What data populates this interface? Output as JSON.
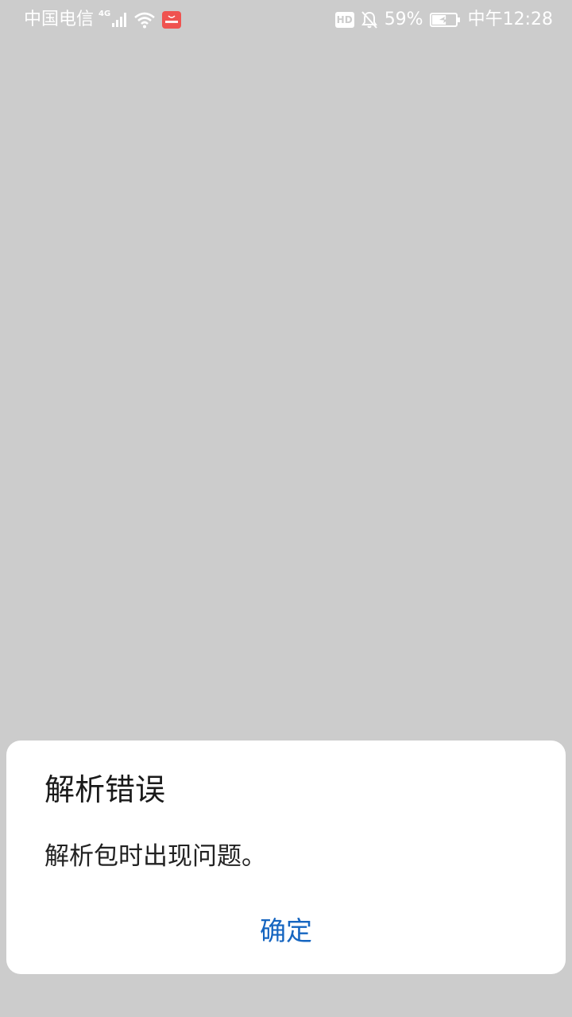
{
  "status_bar": {
    "carrier": "中国电信",
    "network_type": "4G",
    "battery_percent": "59%",
    "time": "中午12:28",
    "hd_label": "HD",
    "app_badge_label": "HUAWEI",
    "icons": [
      "signal-icon",
      "wifi-icon",
      "huawei-appgallery-icon",
      "hd-icon",
      "bell-muted-icon",
      "battery-charging-icon"
    ],
    "battery_level": 0.59
  },
  "dialog": {
    "title": "解析错误",
    "message": "解析包时出现问题。",
    "confirm_label": "确定",
    "accent_color": "#1565c0"
  },
  "colors": {
    "background": "#cccccc",
    "dialog_background": "#ffffff",
    "status_text": "#ffffff"
  }
}
